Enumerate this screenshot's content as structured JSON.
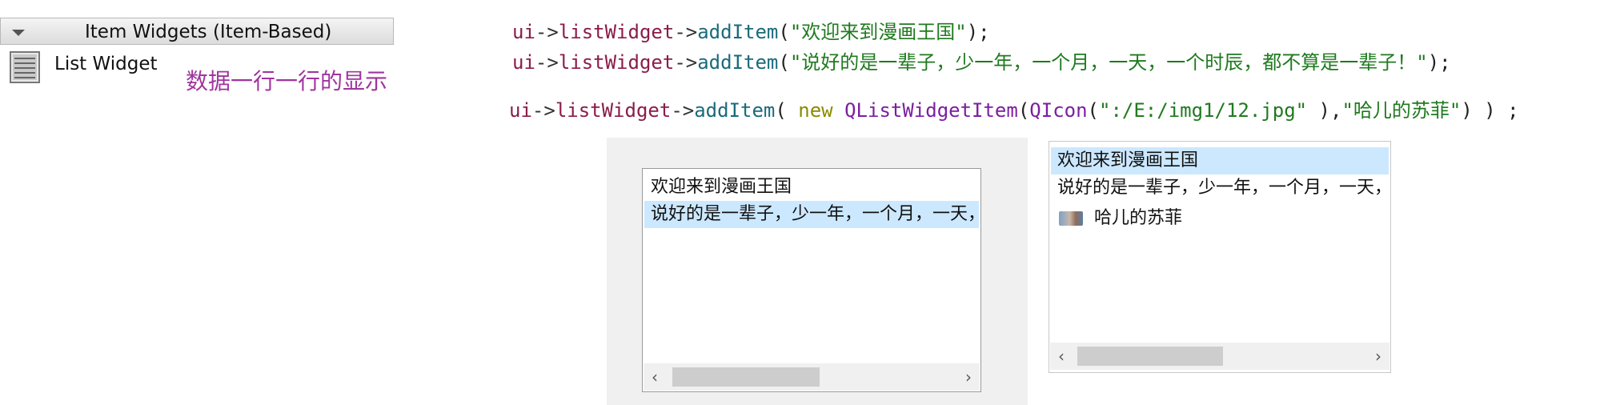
{
  "widget_box": {
    "category_title": "Item Widgets (Item-Based)",
    "item_label": "List Widget"
  },
  "annotation": "数据一行一行的显示",
  "code": {
    "line1": {
      "ui": "ui",
      "arrow1": "->",
      "obj": "listWidget",
      "arrow2": "->",
      "fn": "addItem",
      "open": "(",
      "str": "\"欢迎来到漫画王国\"",
      "close": ");"
    },
    "line2": {
      "ui": "ui",
      "arrow1": "->",
      "obj": "listWidget",
      "arrow2": "->",
      "fn": "addItem",
      "open": "(",
      "str": "\"说好的是一辈子，少一年，一个月，一天，一个时辰，都不算是一辈子！\"",
      "close": ");"
    },
    "line3": {
      "ui": "ui",
      "arrow1": "->",
      "obj": "listWidget",
      "arrow2": "->",
      "fn": "addItem",
      "open": "( ",
      "new": "new",
      "cls": "QListWidgetItem",
      "open2": "(",
      "icon": "QIcon",
      "open3": "(",
      "path": "\":/E:/img1/12.jpg\"",
      "close3": " ),",
      "name": "\"哈儿的苏菲\"",
      "close": ") ) ;"
    }
  },
  "list1": {
    "items": [
      "欢迎来到漫画王国",
      "说好的是一辈子，少一年，一个月，一天，一个时辰，都不算是一辈子！"
    ],
    "selected_index": 1,
    "scroll_left": "‹",
    "scroll_right": "›"
  },
  "list2": {
    "items": [
      "欢迎来到漫画王国",
      "说好的是一辈子，少一年，一个月，一天，一个时辰，都不算是一辈子！",
      "哈儿的苏菲"
    ],
    "selected_index": 0,
    "icon_item_index": 2,
    "scroll_left": "‹",
    "scroll_right": "›"
  },
  "colors": {
    "selection": "#cce8ff",
    "annotation": "#a0349f",
    "string": "#1f7a1f"
  }
}
